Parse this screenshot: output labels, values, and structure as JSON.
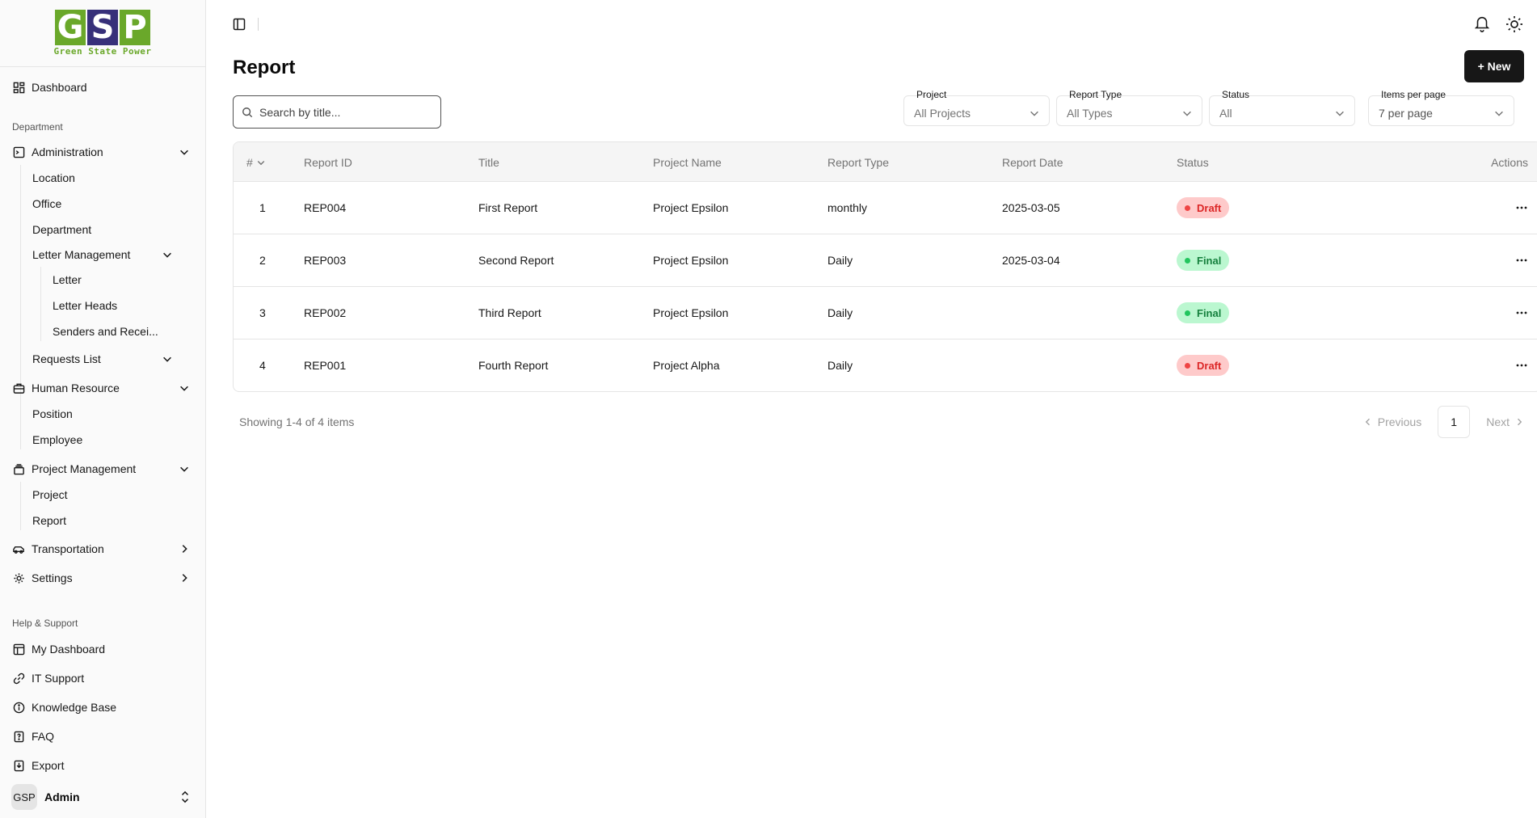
{
  "brand": {
    "logo_letters": [
      "G",
      "S",
      "P"
    ],
    "logo_tagline": "Green State Power",
    "colors": {
      "green": "#6aa82a",
      "purple": "#37307a"
    }
  },
  "sidebar": {
    "dashboard": "Dashboard",
    "department_label": "Department",
    "administration": "Administration",
    "admin_items": [
      "Location",
      "Office",
      "Department"
    ],
    "letter_management": "Letter Management",
    "letter_items": [
      "Letter",
      "Letter Heads",
      "Senders and Recei..."
    ],
    "requests_list": "Requests List",
    "human_resource": "Human Resource",
    "hr_items": [
      "Position",
      "Employee"
    ],
    "project_management": "Project Management",
    "pm_items": [
      "Project",
      "Report"
    ],
    "transportation": "Transportation",
    "settings": "Settings",
    "help_label": "Help & Support",
    "help_items": [
      "My Dashboard",
      "IT Support",
      "Knowledge Base",
      "FAQ",
      "Export"
    ],
    "user": {
      "avatar": "GSP",
      "name": "Admin"
    }
  },
  "page": {
    "title": "Report",
    "new_button": "+ New",
    "search_placeholder": "Search by title..."
  },
  "filters": {
    "project": {
      "label": "Project",
      "value": "All Projects"
    },
    "report_type": {
      "label": "Report Type",
      "value": "All Types"
    },
    "status": {
      "label": "Status",
      "value": "All"
    },
    "items_per_page": {
      "label": "Items per page",
      "value": "7 per page"
    }
  },
  "table": {
    "headers": [
      "#",
      "Report ID",
      "Title",
      "Project Name",
      "Report Type",
      "Report Date",
      "Status",
      "Actions"
    ],
    "rows": [
      {
        "num": "1",
        "id": "REP004",
        "title": "First Report",
        "project": "Project Epsilon",
        "type": "monthly",
        "date": "2025-03-05",
        "status": "Draft"
      },
      {
        "num": "2",
        "id": "REP003",
        "title": "Second Report",
        "project": "Project Epsilon",
        "type": "Daily",
        "date": "2025-03-04",
        "status": "Final"
      },
      {
        "num": "3",
        "id": "REP002",
        "title": "Third Report",
        "project": "Project Epsilon",
        "type": "Daily",
        "date": "",
        "status": "Final"
      },
      {
        "num": "4",
        "id": "REP001",
        "title": "Fourth Report",
        "project": "Project Alpha",
        "type": "Daily",
        "date": "",
        "status": "Draft"
      }
    ]
  },
  "pagination": {
    "showing": "Showing 1-4 of 4 items",
    "previous": "Previous",
    "current_page": "1",
    "next": "Next"
  }
}
